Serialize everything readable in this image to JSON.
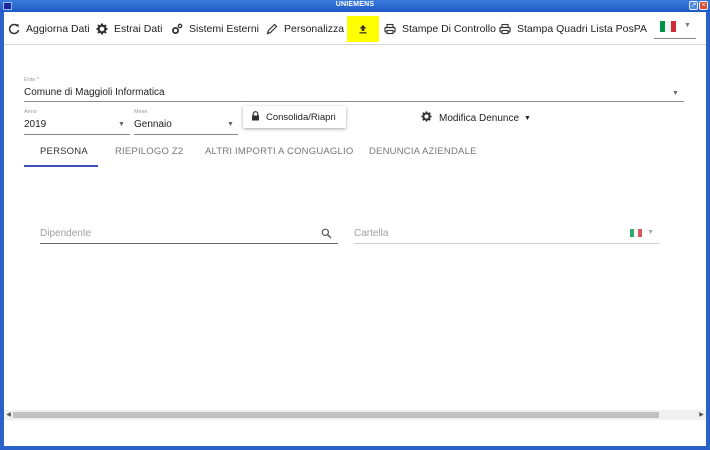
{
  "window": {
    "title": "UNIEMENS"
  },
  "toolbar": {
    "aggiorna": "Aggiorna Dati",
    "estrai": "Estrai Dati",
    "sistemi": "Sistemi Esterni",
    "personalizza": "Personalizza",
    "stampe_controllo": "Stampe Di Controllo",
    "stampa_quadri": "Stampa Quadri Lista PosPA",
    "upload_highlight_color": "#ffff00"
  },
  "language": {
    "selected": "it",
    "flag_colors": [
      "#009246",
      "#ffffff",
      "#ce2b37"
    ]
  },
  "form": {
    "ente_label": "Ente *",
    "ente_value": "Comune di Maggioli Informatica",
    "anno_label": "Anno",
    "anno_value": "2019",
    "mese_label": "Mese",
    "mese_value": "Gennaio"
  },
  "actions": {
    "consolida": "Consolida/Riapri",
    "modifica": "Modifica Denunce"
  },
  "tabs": [
    {
      "label": "PERSONA",
      "active": true
    },
    {
      "label": "RIEPILOGO Z2",
      "active": false
    },
    {
      "label": "ALTRI IMPORTI A CONGUAGLIO",
      "active": false
    },
    {
      "label": "DENUNCIA AZIENDALE",
      "active": false
    }
  ],
  "search": {
    "dipendente_placeholder": "Dipendente",
    "cartella_placeholder": "Cartella"
  },
  "accent_color": "#3f51b5"
}
